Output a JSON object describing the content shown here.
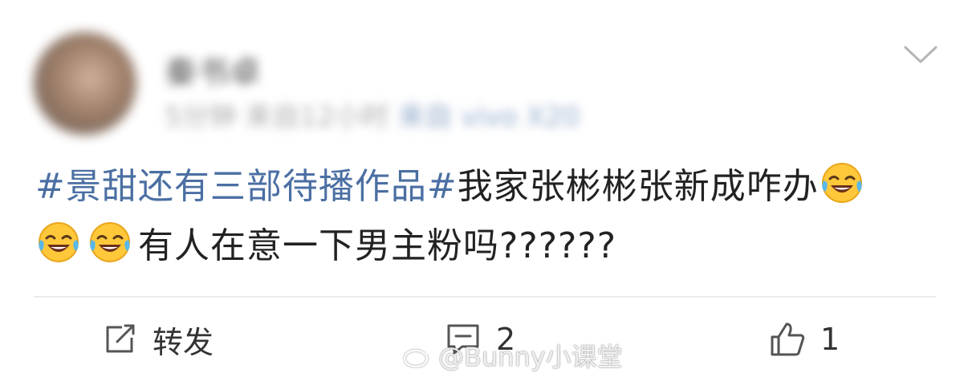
{
  "header": {
    "user_name": "秦书卓",
    "meta_time": "5分钟  来自12小时",
    "meta_source": "来自 vivo X20",
    "chevron_icon": "chevron-down-icon"
  },
  "post": {
    "hashtag": "#景甜还有三部待播作品#",
    "text_line1": "我家张彬彬张新成咋办",
    "text_line2": "有人在意一下男主粉吗??????",
    "emoji_icon": "laughing-crying-emoji-icon"
  },
  "actions": {
    "repost_label": "转发",
    "comment_count": "2",
    "like_count": "1"
  },
  "watermark": {
    "text": "@Bunny小课堂",
    "icon": "weibo-icon"
  },
  "colors": {
    "hashtag": "#4b6fa3",
    "text": "#222222",
    "divider": "#ececec"
  }
}
